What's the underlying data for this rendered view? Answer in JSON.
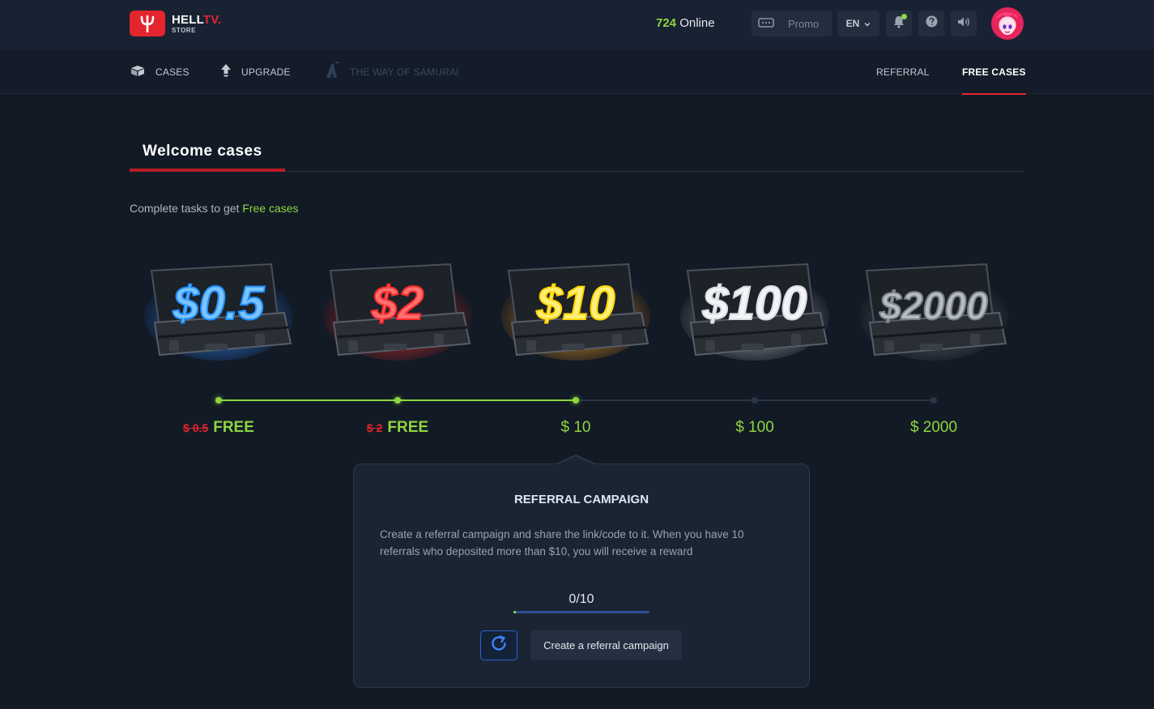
{
  "header": {
    "logo_title_main": "HELL",
    "logo_title_accent": "TV.",
    "logo_sub": "STORE",
    "online_count": "724",
    "online_label": "Online",
    "promo_label": "Promo",
    "lang": "EN"
  },
  "nav": {
    "left": [
      {
        "label": "CASES",
        "icon": "box-icon"
      },
      {
        "label": "UPGRADE",
        "icon": "arrow-up-icon"
      },
      {
        "label": "THE WAY OF SAMURAI",
        "icon": "samurai-icon"
      }
    ],
    "right": [
      {
        "label": "REFERRAL"
      },
      {
        "label": "FREE CASES",
        "active": true
      }
    ]
  },
  "section": {
    "title": "Welcome cases",
    "subtitle_prefix": "Complete tasks to get",
    "subtitle_highlight": "Free cases"
  },
  "cases": [
    {
      "art_label": "$0.5",
      "old_price": "$ 0.5",
      "price": "FREE",
      "reached": true,
      "theme": "blue"
    },
    {
      "art_label": "$2",
      "old_price": "$ 2",
      "price": "FREE",
      "reached": true,
      "theme": "red"
    },
    {
      "art_label": "$10",
      "old_price": "",
      "price": "$ 10",
      "reached": true,
      "theme": "gold"
    },
    {
      "art_label": "$100",
      "old_price": "",
      "price": "$ 100",
      "reached": false,
      "theme": "silver"
    },
    {
      "art_label": "$2000",
      "old_price": "",
      "price": "$ 2000",
      "reached": false,
      "theme": "dark"
    }
  ],
  "progress": {
    "reached_steps": 3,
    "total_steps": 5
  },
  "referral": {
    "title": "REFERRAL CAMPAIGN",
    "description": "Create a referral campaign and share the link/code to it. When you have 10 referrals who deposited more than $10, you will receive a reward",
    "counter": "0/10",
    "progress_fraction": 0.0,
    "create_label": "Create a referral campaign"
  },
  "colors": {
    "accent_red": "#e3262e",
    "accent_green": "#8ed63f",
    "accent_blue": "#2a65c9"
  }
}
